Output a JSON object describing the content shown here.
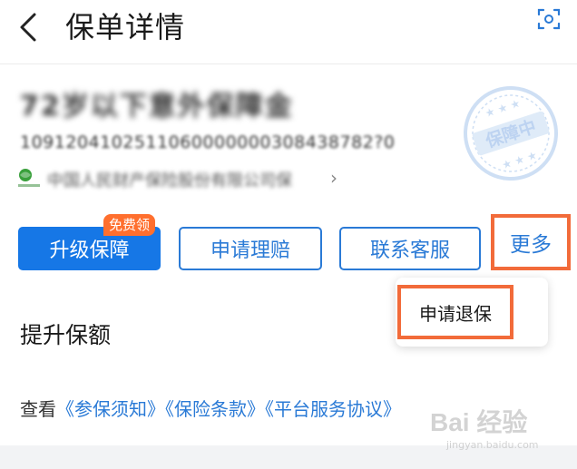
{
  "header": {
    "title": "保单详情",
    "back_icon": "back-arrow-icon",
    "scan_icon": "scan-icon"
  },
  "policy": {
    "name": "72岁以下意外保障金",
    "number": "1091204102511060000000308438782?0",
    "insurer_name": "中国人民财产保险股份有限公司保",
    "insurer_chevron": "›",
    "stamp_text": "保障中"
  },
  "actions": {
    "upgrade_label": "升级保障",
    "free_badge": "免费领",
    "claim_label": "申请理赔",
    "service_label": "联系客服",
    "more_label": "更多"
  },
  "dropdown": {
    "surrender_label": "申请退保"
  },
  "section": {
    "title": "提升保额"
  },
  "terms": {
    "prefix": "查看",
    "links": [
      "《参保须知》",
      "《保险条款》",
      "《平台服务协议》"
    ]
  },
  "watermark": {
    "main": "Bai 经验",
    "sub": "jingyan.baidu.com"
  },
  "colors": {
    "accent": "#2a7ad6",
    "primary_fill": "#1677e6",
    "badge": "#ff6f2e",
    "highlight_box": "#f26b3a"
  }
}
